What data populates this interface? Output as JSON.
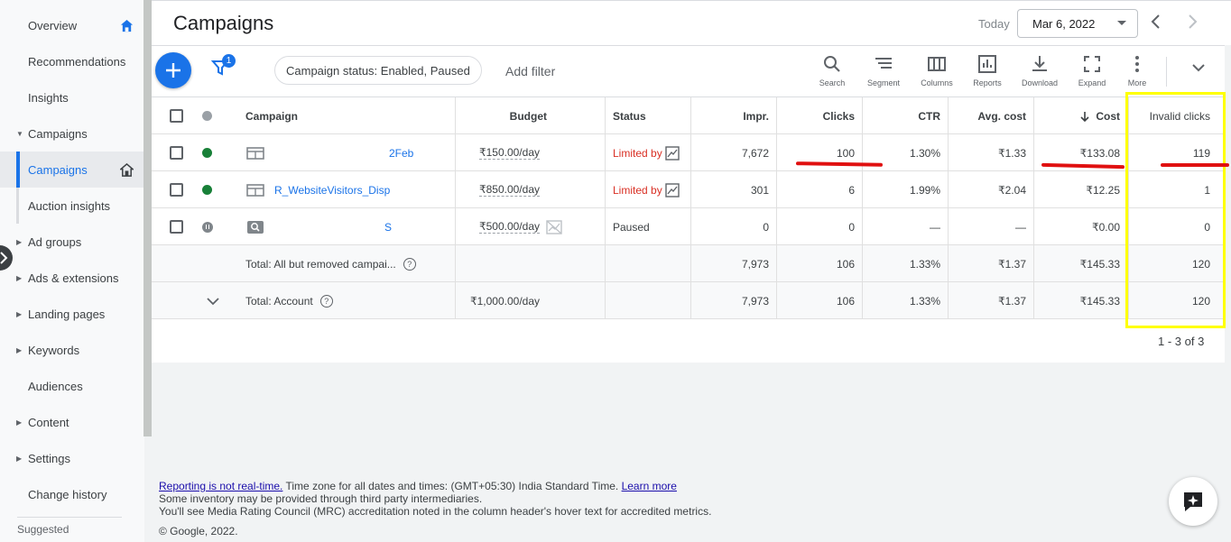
{
  "sidebar": {
    "items": [
      {
        "label": "Overview"
      },
      {
        "label": "Recommendations"
      },
      {
        "label": "Insights"
      },
      {
        "label": "Campaigns"
      },
      {
        "label": "Campaigns"
      },
      {
        "label": "Auction insights"
      },
      {
        "label": "Ad groups"
      },
      {
        "label": "Ads & extensions"
      },
      {
        "label": "Landing pages"
      },
      {
        "label": "Keywords"
      },
      {
        "label": "Audiences"
      },
      {
        "label": "Content"
      },
      {
        "label": "Settings"
      },
      {
        "label": "Change history"
      }
    ],
    "suggested": "Suggested"
  },
  "header": {
    "title": "Campaigns",
    "today_label": "Today",
    "date": "Mar 6, 2022"
  },
  "toolbar": {
    "filter_count": "1",
    "chip_label": "Campaign status: Enabled, Paused",
    "add_filter": "Add filter",
    "tools": [
      "Search",
      "Segment",
      "Columns",
      "Reports",
      "Download",
      "Expand",
      "More"
    ]
  },
  "table": {
    "headers": {
      "campaign": "Campaign",
      "budget": "Budget",
      "status": "Status",
      "impr": "Impr.",
      "clicks": "Clicks",
      "ctr": "CTR",
      "avg_cost": "Avg. cost",
      "cost": "Cost",
      "invalid_clicks": "Invalid clicks"
    },
    "rows": [
      {
        "name": "2Feb",
        "budget": "₹150.00/day",
        "status": "Limited by",
        "impr": "7,672",
        "clicks": "100",
        "ctr": "1.30%",
        "avg_cost": "₹1.33",
        "cost": "₹133.08",
        "invalid": "119"
      },
      {
        "name": "R_WebsiteVisitors_Disp",
        "budget": "₹850.00/day",
        "status": "Limited by",
        "impr": "301",
        "clicks": "6",
        "ctr": "1.99%",
        "avg_cost": "₹2.04",
        "cost": "₹12.25",
        "invalid": "1"
      },
      {
        "name": "S",
        "budget": "₹500.00/day",
        "status": "Paused",
        "impr": "0",
        "clicks": "0",
        "ctr": "—",
        "avg_cost": "—",
        "cost": "₹0.00",
        "invalid": "0"
      }
    ],
    "totals": [
      {
        "label": "Total: All but removed campai...",
        "budget": "",
        "impr": "7,973",
        "clicks": "106",
        "ctr": "1.33%",
        "avg_cost": "₹1.37",
        "cost": "₹145.33",
        "invalid": "120"
      },
      {
        "label": "Total: Account",
        "budget": "₹1,000.00/day",
        "impr": "7,973",
        "clicks": "106",
        "ctr": "1.33%",
        "avg_cost": "₹1.37",
        "cost": "₹145.33",
        "invalid": "120"
      }
    ],
    "pagination": "1 - 3 of 3"
  },
  "footer": {
    "realtime_link": "Reporting is not real-time.",
    "timezone": " Time zone for all dates and times: (GMT+05:30) India Standard Time. ",
    "learn_more": "Learn more",
    "line2": "Some inventory may be provided through third party intermediaries.",
    "line3": "You'll see Media Rating Council (MRC) accreditation noted in the column header's hover text for accredited metrics.",
    "copyright": "© Google, 2022."
  },
  "colors": {
    "accent": "#1a73e8",
    "enabled": "#188038",
    "limited": "#d93025",
    "highlight": "#ffff00",
    "annotation": "#e01010"
  }
}
